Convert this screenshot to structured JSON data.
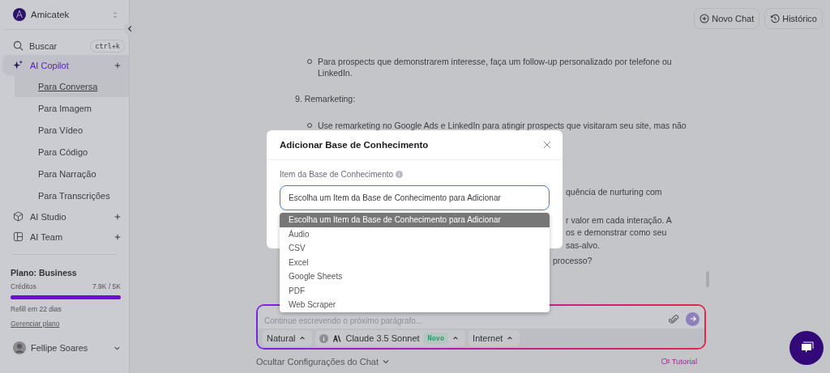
{
  "sidebar": {
    "workspace": "Amicatek",
    "search": {
      "label": "Buscar",
      "shortcut": "ctrl+k"
    },
    "sections": [
      {
        "label": "AI Copilot",
        "kind": "copilot",
        "selected": true,
        "children": [
          {
            "label": "Para Conversa",
            "selected": true
          },
          {
            "label": "Para Imagem",
            "selected": false
          },
          {
            "label": "Para Vídeo",
            "selected": false
          },
          {
            "label": "Para Código",
            "selected": false
          },
          {
            "label": "Para Narração",
            "selected": false
          },
          {
            "label": "Para Transcrições",
            "selected": false
          }
        ]
      },
      {
        "label": "AI Studio",
        "kind": "studio",
        "selected": false
      },
      {
        "label": "AI Team",
        "kind": "team",
        "selected": false
      }
    ],
    "plan": {
      "title": "Plano: Business",
      "credits_label": "Créditos",
      "credits_value": "7.9K / 5K",
      "level": 1,
      "refill": "Refill em 22 dias",
      "manage_link": "Gerenciar plano"
    },
    "user": {
      "name": "Fellipe Soares"
    }
  },
  "header": {
    "buttons": [
      {
        "label": "Novo Chat",
        "kind": "new"
      },
      {
        "label": "Histórico",
        "kind": "history"
      }
    ]
  },
  "chat": {
    "lines": [
      {
        "kind": "bullet",
        "text": "Para prospects que demonstrarem interesse, faça um follow-up personalizado por telefone ou LinkedIn."
      },
      {
        "kind": "numbered",
        "number": "9.",
        "text": "Remarketing:"
      },
      {
        "kind": "bullet",
        "text": "Use remarketing no Google Ads e LinkedIn para atingir prospects que visitaram seu site, mas não"
      },
      {
        "kind": "fragment",
        "text": "quência de nurturing com"
      },
      {
        "kind": "fragment",
        "text": "r valor em cada interação. A"
      },
      {
        "kind": "fragment",
        "text": "os e demonstrar como seu"
      },
      {
        "kind": "fragment",
        "text": "sas-alvo."
      },
      {
        "kind": "fragment",
        "text": "processo?"
      }
    ]
  },
  "modal": {
    "title": "Adicionar Base de Conhecimento",
    "field_label": "Item da Base de Conhecimento",
    "select": {
      "value": "Escolha um Item da Base de Conhecimento para Adicionar",
      "expanded": true,
      "options": [
        {
          "label": "Escolha um Item da Base de Conhecimento para Adicionar",
          "selected": true
        },
        {
          "label": "Áudio",
          "selected": false
        },
        {
          "label": "CSV",
          "selected": false
        },
        {
          "label": "Excel",
          "selected": false
        },
        {
          "label": "Google Sheets",
          "selected": false
        },
        {
          "label": "PDF",
          "selected": false
        },
        {
          "label": "Web Scraper",
          "selected": false
        }
      ]
    }
  },
  "composer": {
    "placeholder": "Continue escrevendo o próximo parágrafo...",
    "chips": [
      {
        "label": "Natural",
        "kind": "plain"
      },
      {
        "label": "Claude 3.5 Sonnet",
        "kind": "model",
        "badge": "Novo"
      },
      {
        "label": "Internet",
        "kind": "plain"
      }
    ],
    "toggle_link": "Ocultar Configurações do Chat",
    "tutorial_link": "Tutorial"
  }
}
